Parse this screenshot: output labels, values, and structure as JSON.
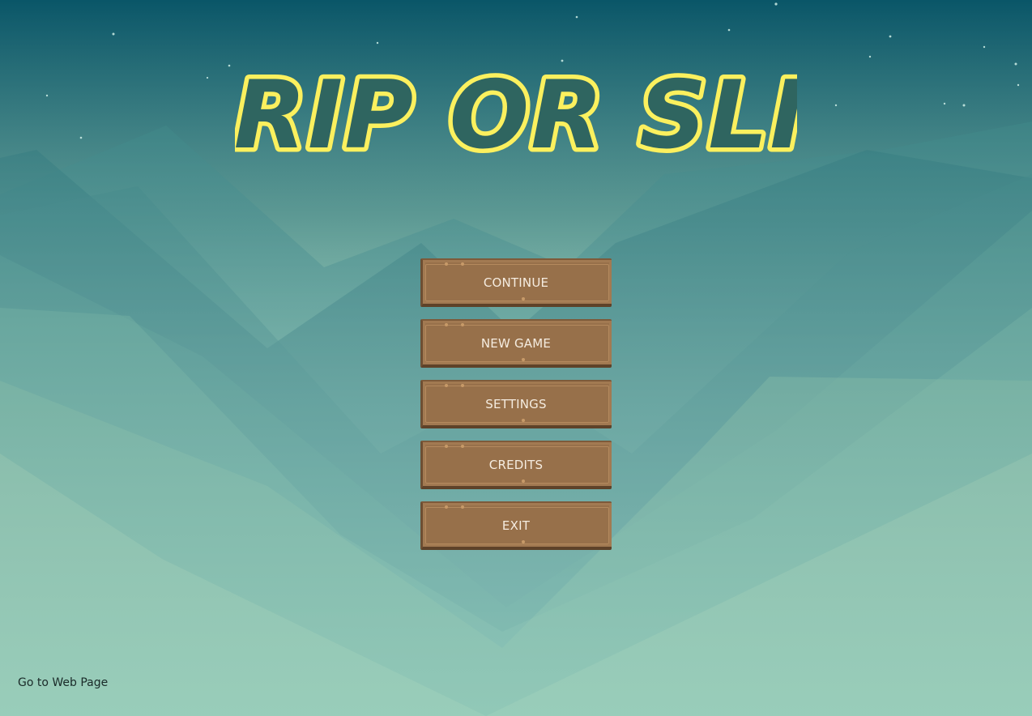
{
  "game": {
    "title": "GRIP OR SLIP"
  },
  "menu": {
    "buttons": [
      {
        "label": "CONTINUE"
      },
      {
        "label": "NEW GAME"
      },
      {
        "label": "SETTINGS"
      },
      {
        "label": "CREDITS"
      },
      {
        "label": "EXIT"
      }
    ]
  },
  "footer": {
    "link_label": "Go to Web Page"
  },
  "colors": {
    "title_fill": "#2f6560",
    "title_outline": "#fbf05e",
    "button_wood": "#97704a",
    "sky_top": "#0b5a6a",
    "ground_glow": "#b6ecd6"
  }
}
